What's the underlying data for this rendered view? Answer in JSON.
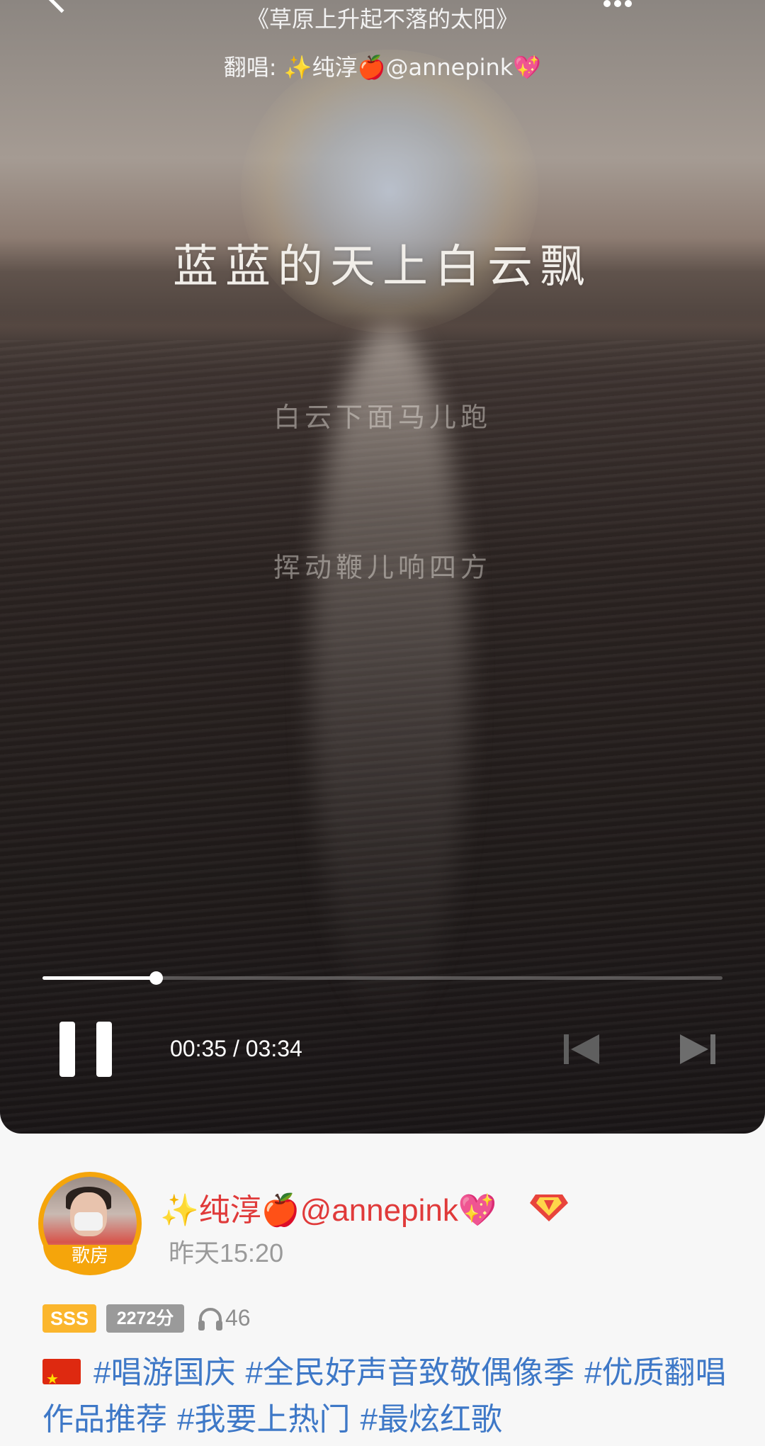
{
  "video": {
    "song_title": "《草原上升起不落的太阳》",
    "singer_prefix": "翻唱: ",
    "singer_name": "✨纯淳🍎@annepink💖",
    "lyric_current": "蓝蓝的天上白云飘",
    "lyric_next_1": "白云下面马儿跑",
    "lyric_next_2": "挥动鞭儿响四方",
    "progress_fraction": 0.167,
    "time_display": "00:35 / 03:34"
  },
  "author": {
    "avatar_badge": "歌房",
    "name": "✨纯淳🍎@annepink💖",
    "time": "昨天15:20"
  },
  "stats": {
    "grade": "SSS",
    "score": "2272分",
    "listens": "46"
  },
  "description": {
    "hashtags": [
      "#唱游国庆",
      "#全民好声音致敬偶像季",
      "#优质翻唱作品推荐",
      "#我要上热门",
      "#最炫红歌"
    ]
  },
  "colors": {
    "accent_orange": "#f5a50b",
    "name_red": "#e03a3a",
    "hashtag_blue": "#3e78c7"
  }
}
